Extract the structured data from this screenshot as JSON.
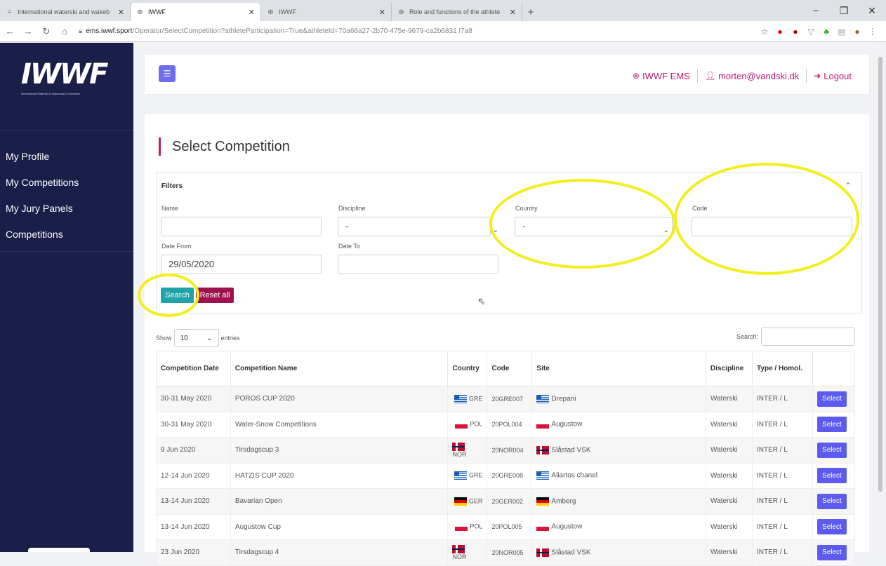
{
  "browser": {
    "tabs": [
      {
        "title": "International waterski and wakeb",
        "icon": "iwwf-favicon",
        "active": false
      },
      {
        "title": "IWWF",
        "icon": "globe-icon",
        "active": true
      },
      {
        "title": "IWWF",
        "icon": "globe-icon",
        "active": false
      },
      {
        "title": "Role and functions of the athlete",
        "icon": "globe-icon",
        "active": false
      }
    ],
    "url_host": "ems.iwwf.sport",
    "url_path": "/Operator/SelectCompetition?athleteParticipation=True&athleteId=70a66a27-2b70-475e-9679-ca2b6831 I7a8"
  },
  "sidebar": {
    "logo": "IWWF",
    "logo_sub": "International Waterski & Wakeboard Federation",
    "items": [
      {
        "label": "My Profile"
      },
      {
        "label": "My Competitions"
      },
      {
        "label": "My Jury Panels"
      },
      {
        "label": "Competitions"
      }
    ]
  },
  "header": {
    "ems_link": "IWWF EMS",
    "user_email": "morten@vandski.dk",
    "logout": "Logout"
  },
  "page": {
    "title": "Select Competition"
  },
  "filters": {
    "title": "Filters",
    "name_label": "Name",
    "name_value": "",
    "discipline_label": "Discipline",
    "discipline_value": "-",
    "country_label": "Country",
    "country_value": "-",
    "code_label": "Code",
    "code_value": "",
    "date_from_label": "Date From",
    "date_from_value": "29/05/2020",
    "date_to_label": "Date To",
    "date_to_value": "",
    "search_button": "Search",
    "reset_button": "Reset all"
  },
  "table_controls": {
    "show_label": "Show",
    "length_value": "10",
    "entries_label": "entries",
    "search_label": "Search:"
  },
  "table": {
    "headers": [
      "Competition Date",
      "Competition Name",
      "Country",
      "Code",
      "Site",
      "Discipline",
      "Type / Homol.",
      ""
    ],
    "select_label": "Select",
    "rows": [
      {
        "date": "30-31 May 2020",
        "name": "POROS CUP 2020",
        "flag": "gre",
        "country": "GRE",
        "code": "20GRE007",
        "site": "Drepani",
        "discipline": "Waterski",
        "type": "INTER / L"
      },
      {
        "date": "30-31 May 2020",
        "name": "Water-Snow Competitions",
        "flag": "pol",
        "country": "POL",
        "code": "20POL004",
        "site": "Augustow",
        "discipline": "Waterski",
        "type": "INTER / L"
      },
      {
        "date": "9 Jun 2020",
        "name": "Tirsdagscup 3",
        "flag": "nor",
        "country": "NOR",
        "code": "20NOR004",
        "site": "Slåstad VSK",
        "discipline": "Waterski",
        "type": "INTER / L"
      },
      {
        "date": "12-14 Jun 2020",
        "name": "HATZIS CUP 2020",
        "flag": "gre",
        "country": "GRE",
        "code": "20GRE008",
        "site": "Aliartos chanel",
        "discipline": "Waterski",
        "type": "INTER / L"
      },
      {
        "date": "13-14 Jun 2020",
        "name": "Bavarian Open",
        "flag": "ger",
        "country": "GER",
        "code": "20GER002",
        "site": "Amberg",
        "discipline": "Waterski",
        "type": "INTER / L"
      },
      {
        "date": "13-14 Jun 2020",
        "name": "Augustow Cup",
        "flag": "pol",
        "country": "POL",
        "code": "20POL005",
        "site": "Augustow",
        "discipline": "Waterski",
        "type": "INTER / L"
      },
      {
        "date": "23 Jun 2020",
        "name": "Tirsdagscup 4",
        "flag": "nor",
        "country": "NOR",
        "code": "20NOR005",
        "site": "Slåstad VSK",
        "discipline": "Waterski",
        "type": "INTER / L"
      }
    ]
  },
  "colors": {
    "sidebar_bg": "#1a1f4a",
    "accent": "#c11a6e",
    "search_btn": "#1fa3a8",
    "reset_btn": "#a0124e",
    "select_btn": "#5b5bf0",
    "highlight": "#f4ee1e"
  }
}
